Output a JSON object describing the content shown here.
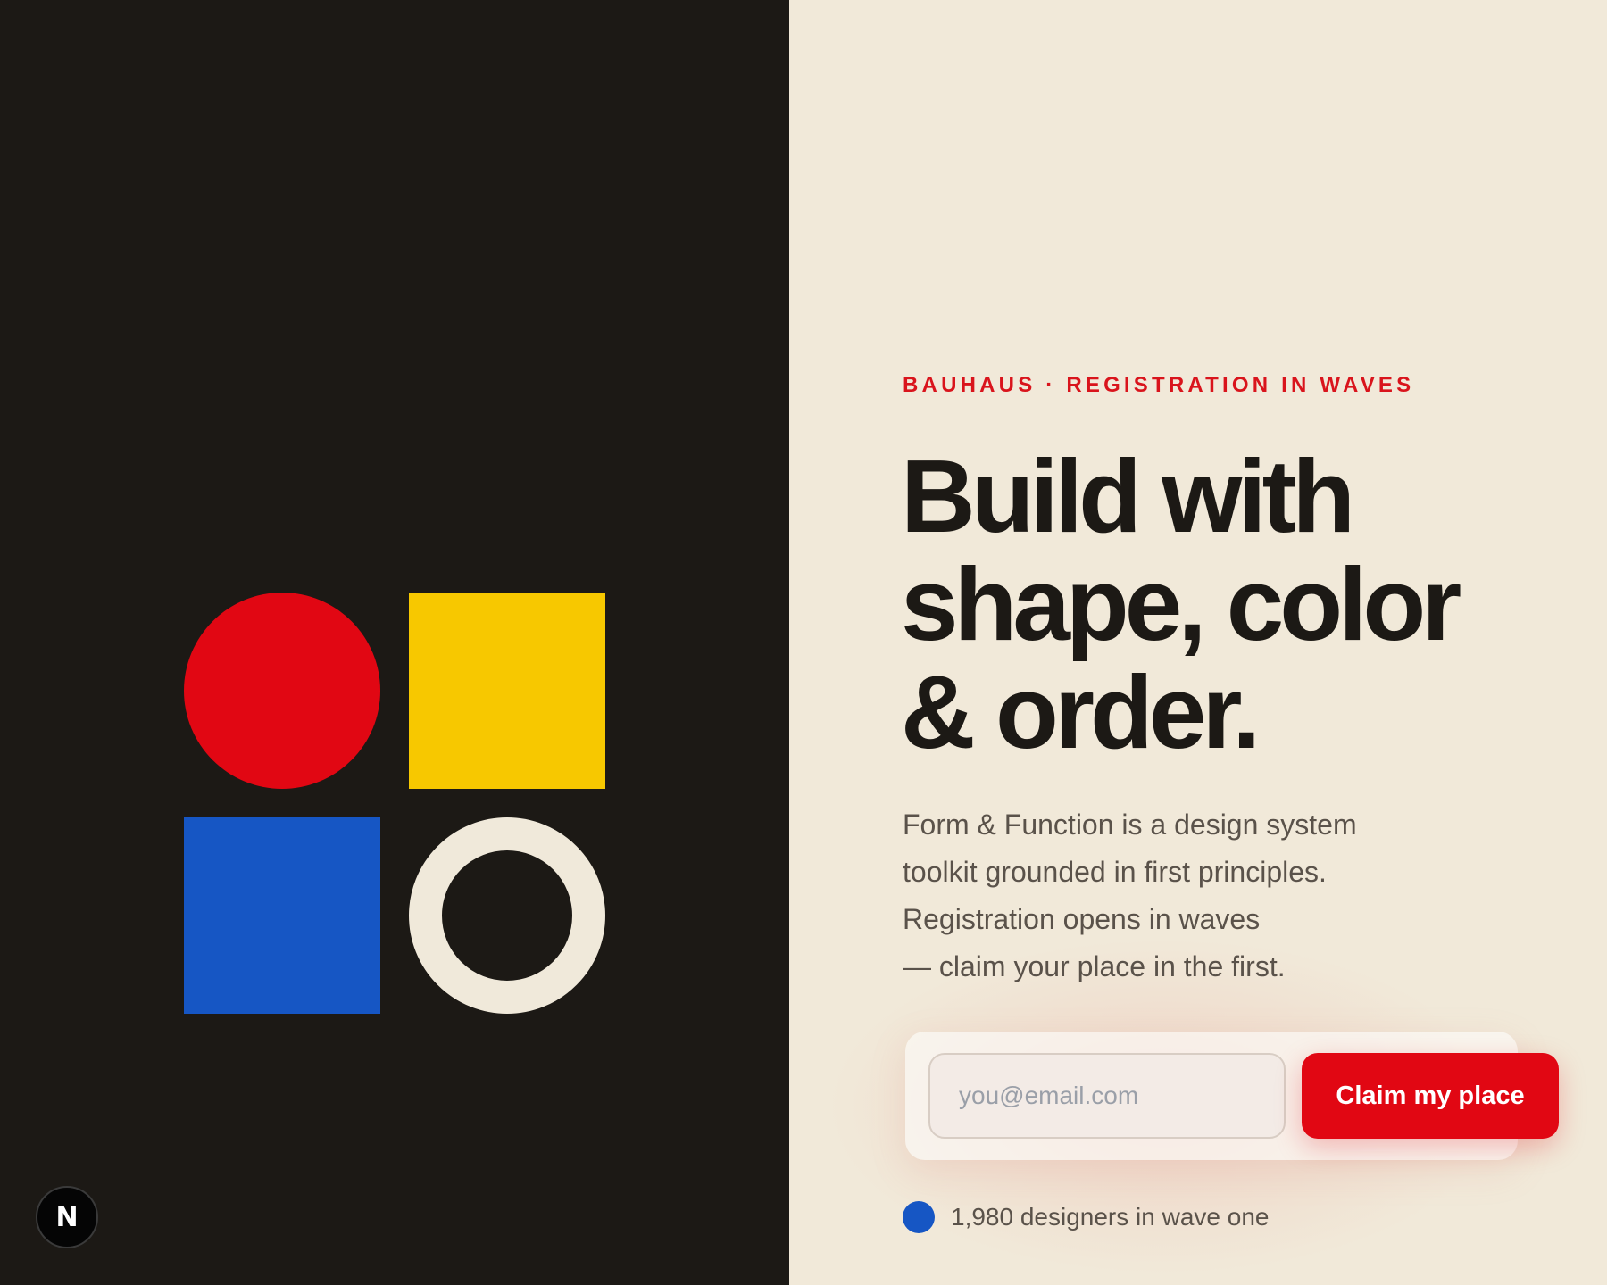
{
  "brand": {
    "badge_letter": "N"
  },
  "hero": {
    "eyebrow": "BAUHAUS · REGISTRATION IN WAVES",
    "headline_lines": [
      "Build with",
      "shape, color",
      "& order."
    ],
    "description_lines": [
      "Form & Function is a design system",
      "toolkit grounded in first principles.",
      "Registration opens in waves",
      "— claim your place in the first."
    ]
  },
  "signup": {
    "email_placeholder": "you@email.com",
    "email_value": "",
    "submit_label": "Claim my place"
  },
  "counter": {
    "text": "1,980 designers in wave one"
  },
  "colors": {
    "dark_bg": "#1c1915",
    "cream_bg": "#f1e9d9",
    "red": "#e10713",
    "yellow": "#f7c800",
    "blue": "#1656c4",
    "cream_ring": "#f0e9da"
  },
  "icons": {
    "badge": "n-logo-icon",
    "counter_dot": "blue-dot-icon"
  }
}
